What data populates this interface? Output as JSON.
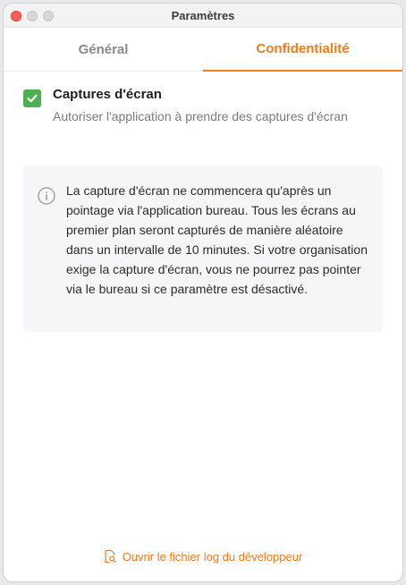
{
  "window": {
    "title": "Paramètres"
  },
  "tabs": [
    {
      "label": "Général",
      "active": false
    },
    {
      "label": "Confidentialité",
      "active": true
    }
  ],
  "setting": {
    "title": "Captures d'écran",
    "description": "Autoriser l'application à prendre des captures d'écran",
    "checked": true,
    "checkbox_color": "#4caf50"
  },
  "info": {
    "icon": "info-icon",
    "text": "La capture d'écran ne commencera qu'après un pointage via l'application bureau. Tous les écrans au premier plan seront capturés de manière aléatoire dans un intervalle de 10 minutes. Si votre organisation exige la capture d'écran, vous ne pourrez pas pointer via le bureau si ce paramètre est désactivé."
  },
  "footer": {
    "icon": "log-file-search-icon",
    "link_label": "Ouvrir le fichier log du développeur"
  },
  "colors": {
    "accent": "#ef7d1c",
    "success": "#4caf50"
  }
}
